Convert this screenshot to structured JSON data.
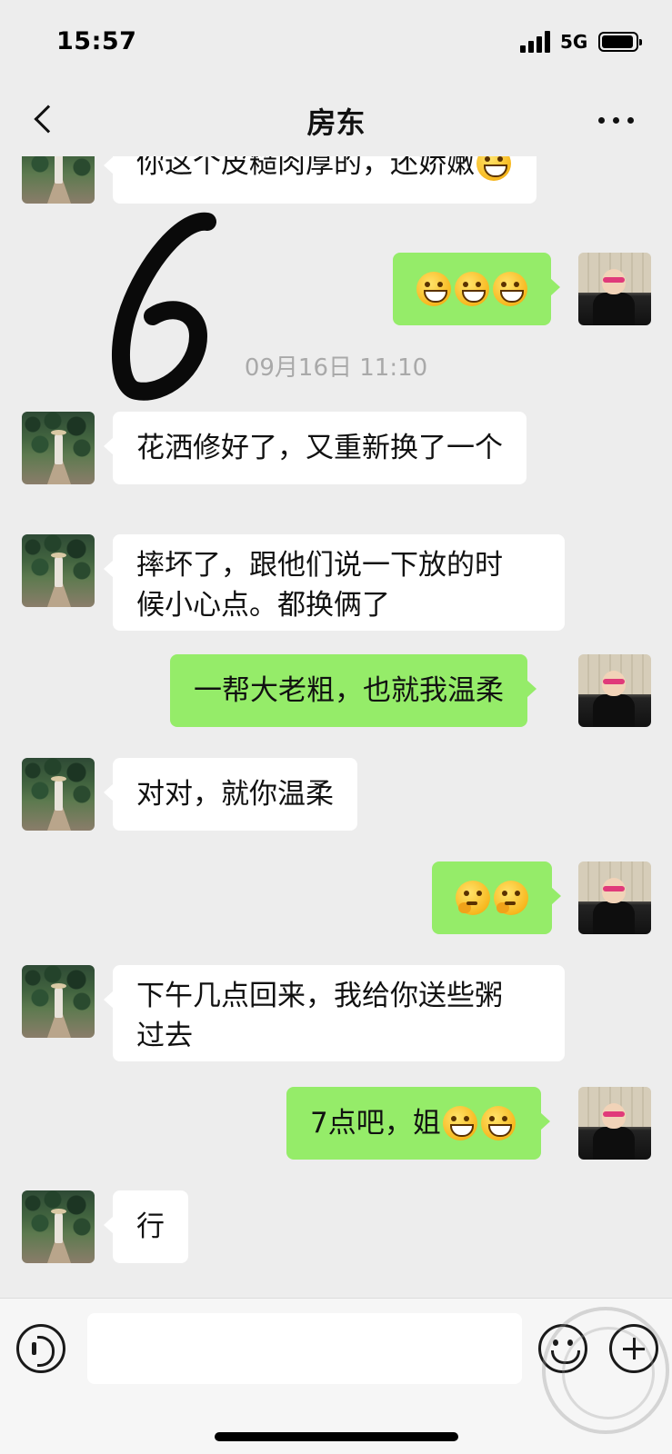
{
  "status_bar": {
    "time": "15:57",
    "network": "5G"
  },
  "header": {
    "title": "房东"
  },
  "messages": [
    {
      "side": "in",
      "text": "你这个皮糙肉厚的，还娇嫩"
    },
    {
      "side": "out",
      "emojis": [
        "grin",
        "grin",
        "grin"
      ]
    },
    {
      "timestamp": "09月16日 11:10"
    },
    {
      "side": "in",
      "text": "花洒修好了，又重新换了一个"
    },
    {
      "side": "in",
      "line1": "摔坏了，跟他们说一下放的时",
      "line2": "候小心点。都换俩了"
    },
    {
      "side": "out",
      "text": "一帮大老粗，也就我温柔"
    },
    {
      "side": "in",
      "text": "对对，就你温柔"
    },
    {
      "side": "out",
      "emojis": [
        "think",
        "think"
      ]
    },
    {
      "side": "in",
      "line1": "下午几点回来，我给你送些粥",
      "line2": "过去"
    },
    {
      "side": "out",
      "text": "7点吧，姐",
      "emojis": [
        "grin",
        "grin"
      ]
    },
    {
      "side": "in",
      "text": "行"
    }
  ],
  "input": {
    "value": ""
  },
  "icons": {
    "back": "chevron-left-icon",
    "more": "more-icon",
    "voice": "voice-icon",
    "emoji": "emoji-icon",
    "plus": "plus-icon"
  }
}
